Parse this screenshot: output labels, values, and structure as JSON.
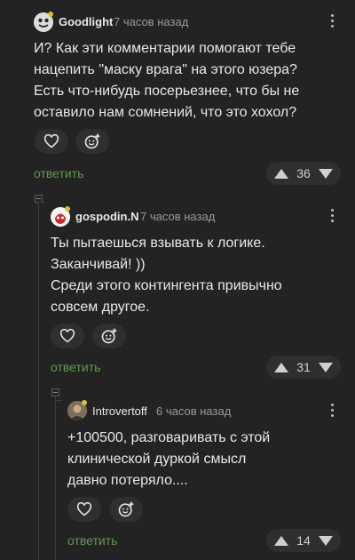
{
  "comments": [
    {
      "author": "Goodlight",
      "time": "7 часов назад",
      "lines": [
        "И? Как эти комментарии помогают тебе",
        "нацепить \"маску врага\" на этого юзера?",
        "Есть что-нибудь посерьезнее, что бы не",
        "оставило нам сомнений, что это хохол?"
      ],
      "reply": "ответить",
      "rating": "36"
    },
    {
      "author": "gospodin.N",
      "time": "7 часов назад",
      "lines": [
        "Ты пытаешься взывать к логике.",
        "Заканчивай! ))",
        "Среди этого контингента привычно",
        "совсем другое."
      ],
      "reply": "ответить",
      "rating": "31"
    },
    {
      "author": "Introvertoff",
      "time": "6 часов назад",
      "lines": [
        "+100500, разговаривать с этой",
        "клинической дуркой смысл",
        "давно потеряло...."
      ],
      "reply": "ответить",
      "rating": "14"
    }
  ],
  "icons": {
    "like": "heart-icon",
    "reaction": "emoji-add-icon",
    "upvote": "arrow-up-icon",
    "downvote": "arrow-down-icon",
    "menu": "more-vertical-icon"
  },
  "colors": {
    "background": "#232323",
    "reply": "#5f9a4a",
    "online": "#d6c23a"
  }
}
